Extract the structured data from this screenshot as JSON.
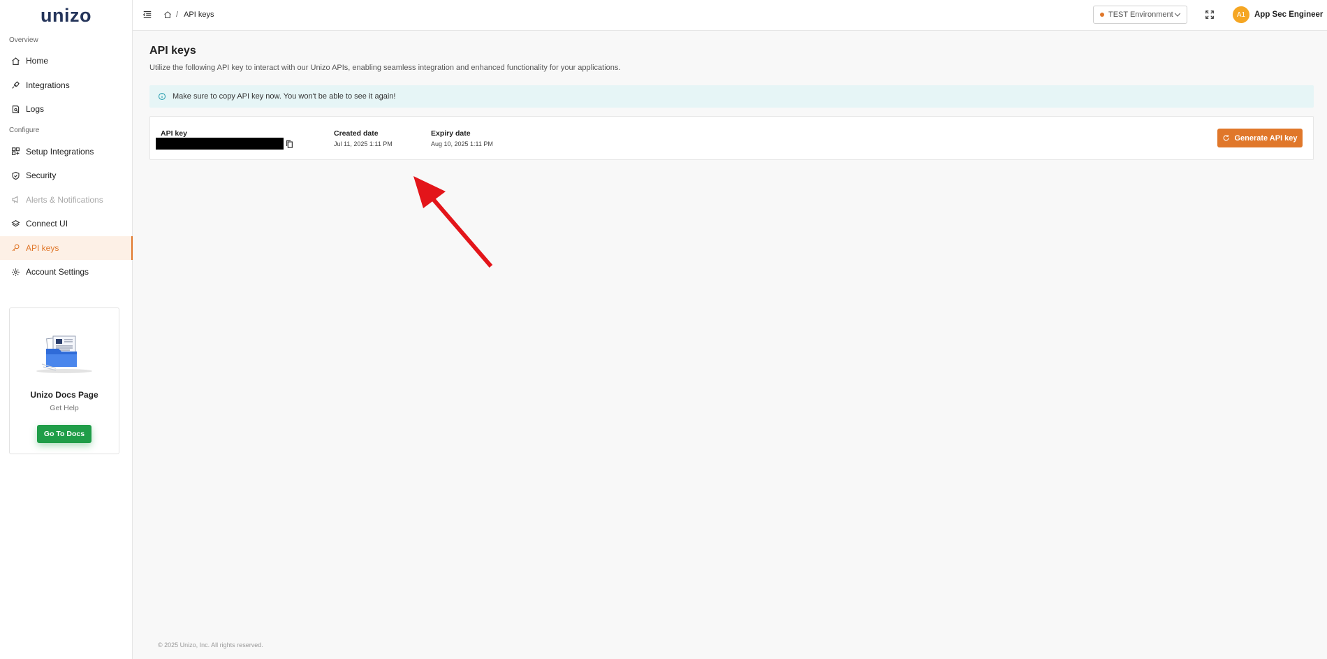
{
  "app": {
    "logo_text": "unizo"
  },
  "sidebar": {
    "sections": [
      {
        "label": "Overview",
        "items": [
          {
            "label": "Home",
            "icon": "home-icon"
          },
          {
            "label": "Integrations",
            "icon": "plug-icon"
          },
          {
            "label": "Logs",
            "icon": "logs-icon"
          }
        ]
      },
      {
        "label": "Configure",
        "items": [
          {
            "label": "Setup Integrations",
            "icon": "apps-icon"
          },
          {
            "label": "Security",
            "icon": "shield-icon"
          },
          {
            "label": "Alerts & Notifications",
            "icon": "megaphone-icon",
            "disabled": true
          },
          {
            "label": "Connect UI",
            "icon": "layers-icon"
          },
          {
            "label": "API keys",
            "icon": "key-icon",
            "active": true
          },
          {
            "label": "Account Settings",
            "icon": "gear-icon"
          }
        ]
      }
    ],
    "docs_card": {
      "title": "Unizo Docs Page",
      "subtitle": "Get Help",
      "button_label": "Go To Docs"
    }
  },
  "topbar": {
    "breadcrumb_current": "API keys",
    "breadcrumb_separator": "/",
    "environment": "TEST Environment",
    "avatar_initials": "A1",
    "user_name": "App Sec Engineer"
  },
  "main": {
    "title": "API keys",
    "description": "Utilize the following API key to interact with our Unizo APIs, enabling seamless integration and enhanced functionality for your applications.",
    "alert_text": "Make sure to copy API key now. You won't be able to see it again!",
    "key_card": {
      "api_key_label": "API key",
      "created_label": "Created date",
      "created_value": "Jul 11, 2025 1:11 PM",
      "expiry_label": "Expiry date",
      "expiry_value": "Aug 10, 2025 1:11 PM",
      "generate_button": "Generate API key"
    },
    "footer": "© 2025 Unizo, Inc. All rights reserved."
  },
  "colors": {
    "accent": "#e0772a",
    "docs_button": "#1f9d48",
    "alert_bg": "#e6f5f6",
    "annotation_arrow": "#e3151a"
  }
}
